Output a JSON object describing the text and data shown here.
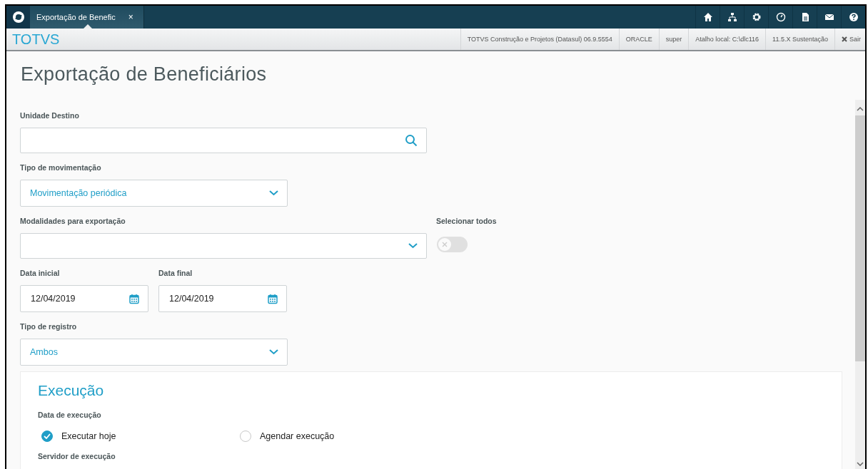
{
  "tab_bar": {
    "tabs": [
      {
        "label": "Exportação de Benefic",
        "selected": true,
        "close": "×"
      }
    ]
  },
  "header": {
    "brand": "TOTVS",
    "info": [
      "TOTVS Construção e Projetos (Datasul) 06.9.5554",
      "ORACLE",
      "super",
      "Atalho local: C:\\dlc116",
      "11.5.X Sustentação"
    ],
    "logout": "Sair"
  },
  "page": {
    "title": "Exportação de Beneficiários",
    "fields": [
      {
        "kind": "lookup",
        "label": "Unidade Destino"
      },
      {
        "kind": "select",
        "label": "Tipo de movimentação",
        "value": "Movimentação periódica"
      },
      {
        "kind": "multiselect",
        "label": "Modalidades para exportação",
        "toggle": {
          "label": "Selecionar todos",
          "on": false
        }
      },
      {
        "kind": "dates",
        "items": [
          {
            "label": "Data inicial",
            "value": "12/04/2019"
          },
          {
            "label": "Data final",
            "value": "12/04/2019"
          }
        ]
      },
      {
        "kind": "select",
        "label": "Tipo de registro",
        "value": "Ambos"
      }
    ],
    "execution": {
      "title": "Execução",
      "date_label": "Data de execução",
      "options": [
        {
          "label": "Executar hoje",
          "selected": true
        },
        {
          "label": "Agendar execução",
          "selected": false
        }
      ],
      "server_label": "Servidor de execução"
    }
  }
}
